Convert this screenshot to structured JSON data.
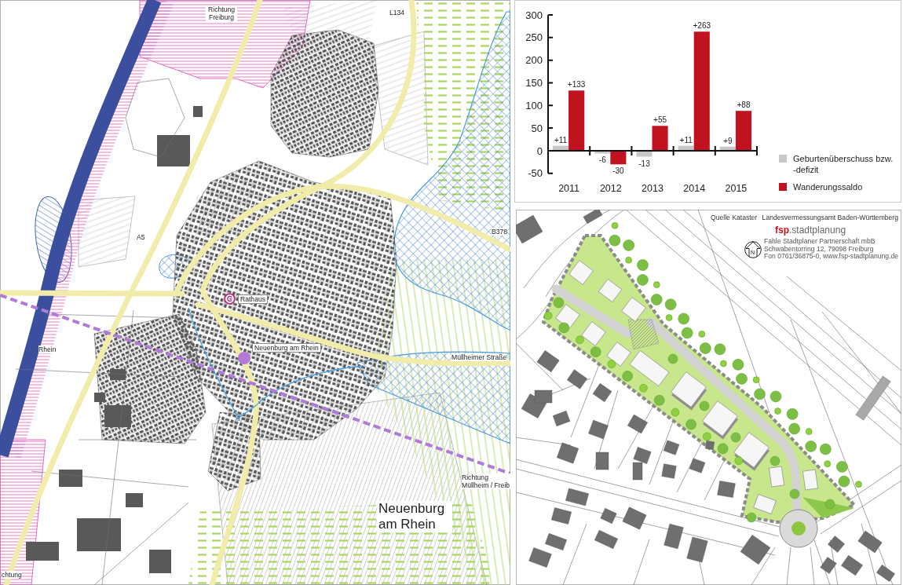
{
  "map": {
    "labels": [
      {
        "kind": "direction",
        "text": "Richtung Freiburg"
      },
      {
        "kind": "road",
        "text": "L134"
      },
      {
        "kind": "road",
        "text": "A5"
      },
      {
        "kind": "road",
        "text": "B378"
      },
      {
        "kind": "landmark",
        "text": "Rathaus"
      },
      {
        "kind": "water",
        "text": "Rhein"
      },
      {
        "kind": "station",
        "text": "Neuenburg am Rhein"
      },
      {
        "kind": "street",
        "text": "Müllheimer Straße"
      },
      {
        "kind": "direction",
        "text": "Richtung Müllheim / Freib"
      },
      {
        "kind": "town",
        "text": "Neuenburg am Rhein"
      },
      {
        "kind": "direction",
        "text": "chtung"
      }
    ]
  },
  "chart": {
    "chart_data": {
      "type": "bar",
      "categories": [
        "2011",
        "2012",
        "2013",
        "2014",
        "2015"
      ],
      "series": [
        {
          "name": "Geburtenüberschuss bzw. -defizit",
          "color": "#c8c8c8",
          "values": [
            11,
            -6,
            -13,
            11,
            9
          ]
        },
        {
          "name": "Wanderungssaldo",
          "color": "#c1121f",
          "values": [
            133,
            -30,
            55,
            263,
            88
          ]
        }
      ],
      "ylim": [
        -50,
        300
      ],
      "yticks": [
        -50,
        0,
        50,
        100,
        150,
        200,
        250,
        300
      ],
      "value_labels": [
        [
          "+11",
          "-6",
          "-13",
          "+11",
          "+9"
        ],
        [
          "+133",
          "-30",
          "+55",
          "+263",
          "+88"
        ]
      ],
      "legend": "right"
    }
  },
  "site_plan": {
    "source_note": "Quelle Kataster",
    "survey_note": "Landesvermessungsamt Baden-Württemberg",
    "logo": "**fsp**.stadtplanung",
    "address_lines": [
      "Fahle Stadtplaner Partnerschaft mbB",
      "Schwabentorring 12, 79098 Freiburg",
      "Fon 0761/36875-0, www.fsp-stadtplanung.de"
    ],
    "north_label": "N"
  }
}
